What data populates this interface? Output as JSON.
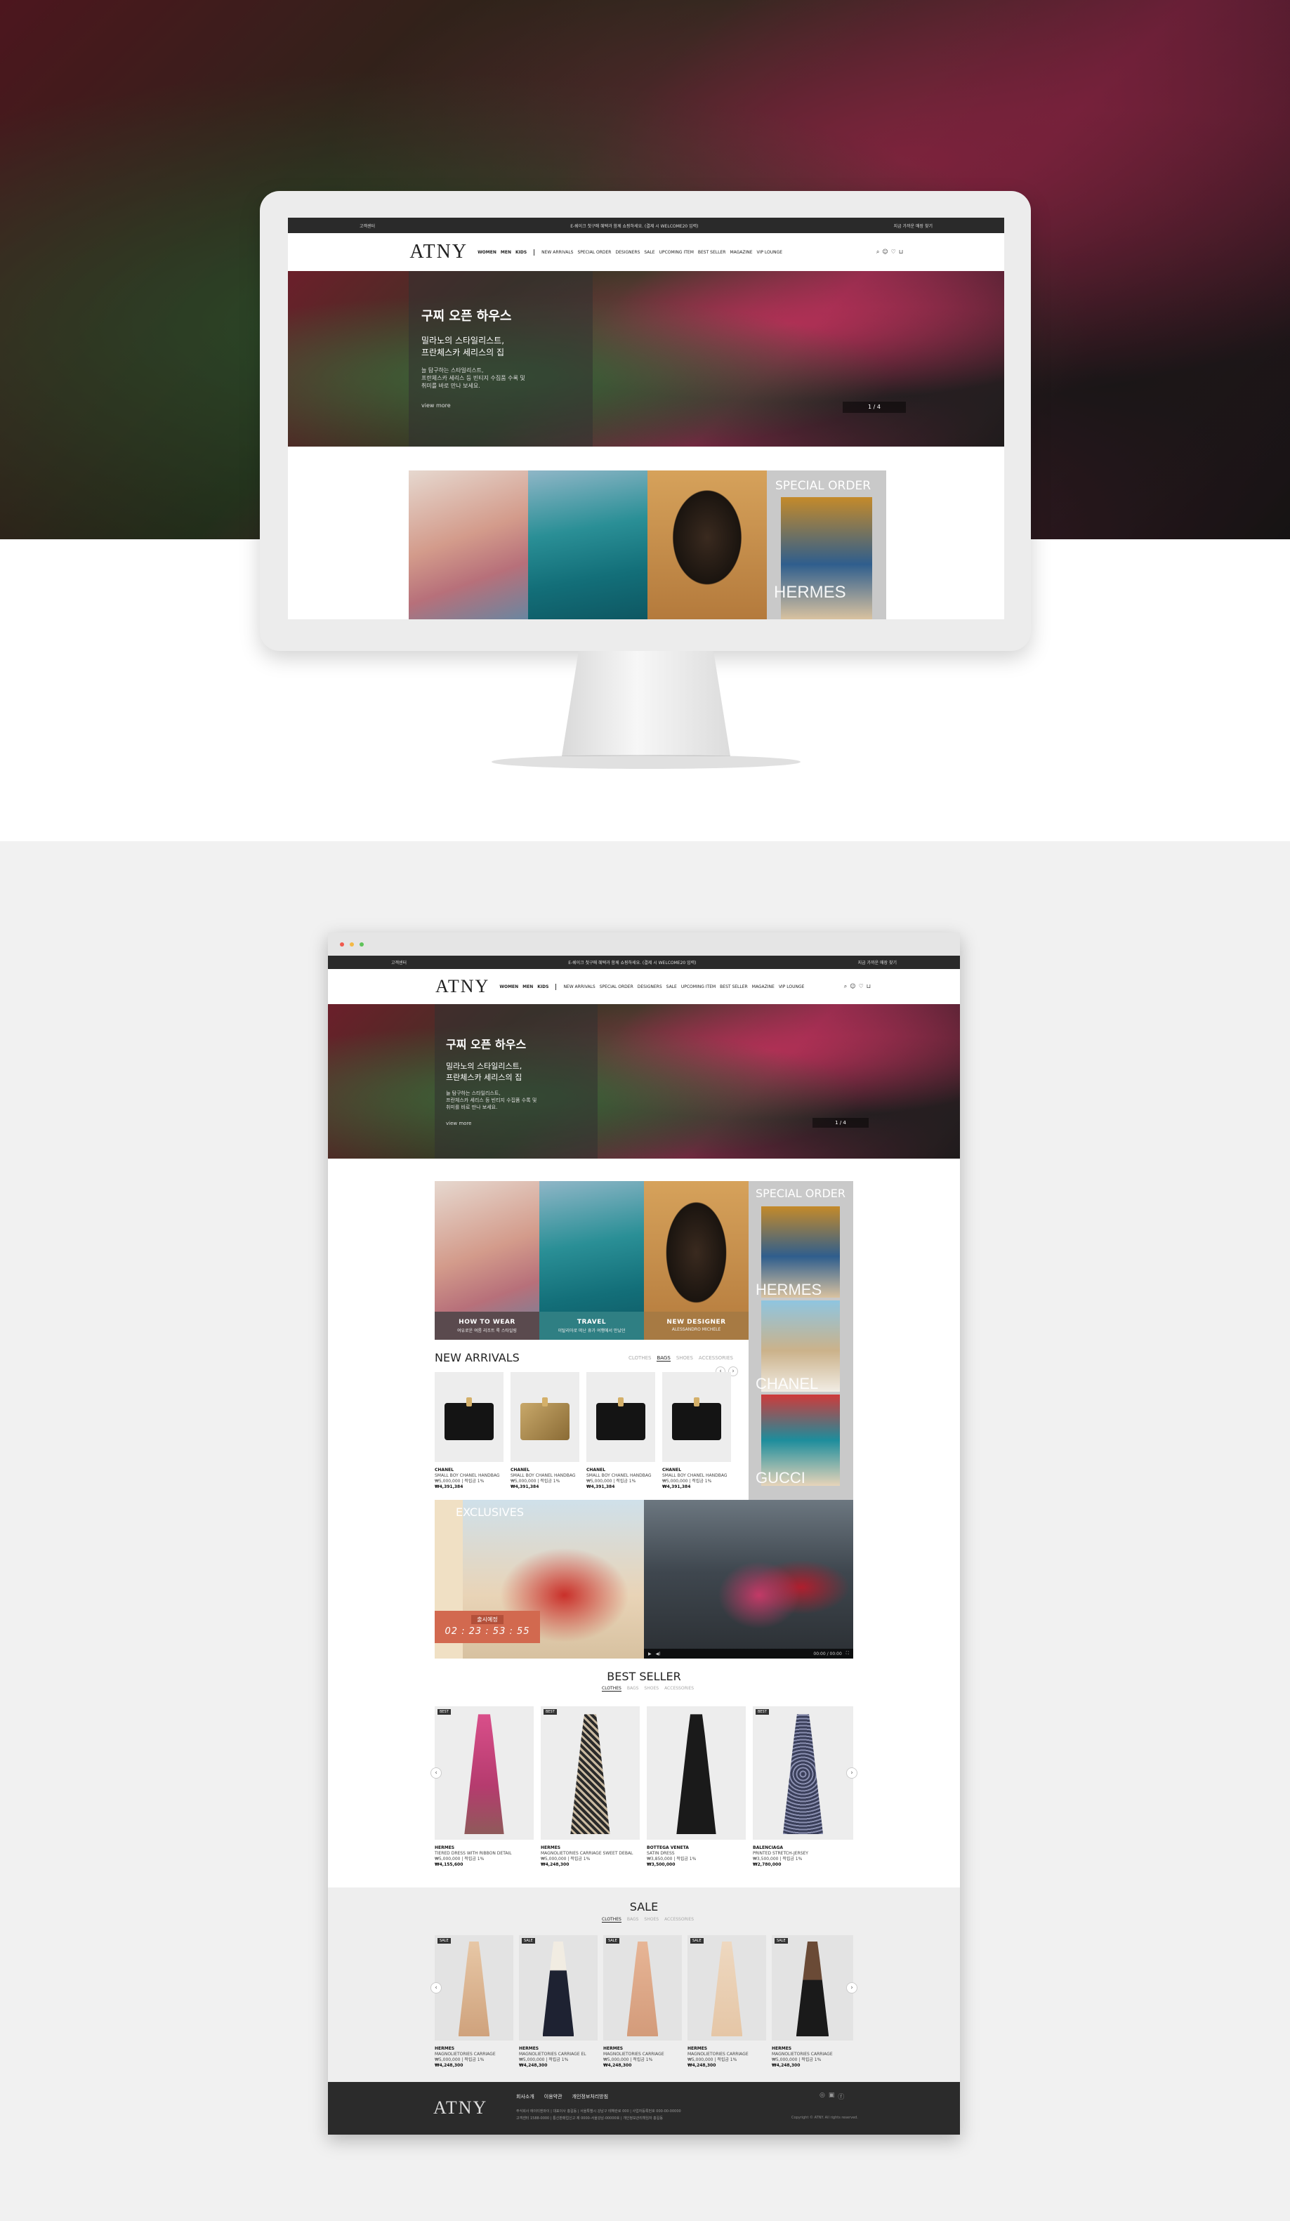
{
  "site": {
    "logo": "ATNY",
    "topbar": {
      "left": "고객센터",
      "center": "E-쉐이크 첫구매 혜택과 함께 쇼핑하세요. (결제 시 WELCOME20 입력)",
      "right": "지금 가까운 매장 찾기"
    },
    "menu": {
      "primary": [
        "WOMEN",
        "MEN",
        "KIDS"
      ],
      "secondary": [
        "NEW ARRIVALS",
        "SPECIAL ORDER",
        "DESIGNERS",
        "SALE",
        "UPCOMING ITEM",
        "BEST SELLER",
        "MAGAZINE",
        "VIP LOUNGE"
      ]
    },
    "tools": [
      "search-icon",
      "user-icon",
      "heart-icon",
      "bag-icon"
    ]
  },
  "hero": {
    "title": "구찌 오픈 하우스",
    "subtitle_line1": "밀라노의 스타일리스트,",
    "subtitle_line2": "프란체스카 세리스의 집",
    "body_line1": "늘 탐구하는 스타일리스트,",
    "body_line2": "프란체스카 세리스 등 빈티지 수집품 수록 및",
    "body_line3": "취미를 바로 만나 보세요.",
    "more": "view more",
    "pager": "1 / 4"
  },
  "tiles": [
    {
      "title": "HOW TO WEAR",
      "sub": "여유로운 여름 리조트 룩 스타일링"
    },
    {
      "title": "TRAVEL",
      "sub": "이탈리아로 떠난 휴가 여행에서 만났던"
    },
    {
      "title": "NEW DESIGNER",
      "sub": "ALESSANDRO MICHELE"
    }
  ],
  "special_order": {
    "title": "SPECIAL ORDER",
    "brands": [
      "HERMES",
      "CHANEL",
      "GUCCI"
    ]
  },
  "new_arrivals": {
    "title": "NEW ARRIVALS",
    "tabs": [
      "CLOTHES",
      "BAGS",
      "SHOES",
      "ACCESSORIES"
    ],
    "active_tab": "BAGS",
    "items": [
      {
        "brand": "CHANEL",
        "name": "SMALL BOY CHANEL HANDBAG",
        "sub": "₩5,000,000 | 적립금 1%",
        "price": "₩4,391,384"
      },
      {
        "brand": "CHANEL",
        "name": "SMALL BOY CHANEL HANDBAG",
        "sub": "₩5,000,000 | 적립금 1%",
        "price": "₩4,391,384"
      },
      {
        "brand": "CHANEL",
        "name": "SMALL BOY CHANEL HANDBAG",
        "sub": "₩5,000,000 | 적립금 1%",
        "price": "₩4,391,384"
      },
      {
        "brand": "CHANEL",
        "name": "SMALL BOY CHANEL HANDBAG",
        "sub": "₩5,000,000 | 적립금 1%",
        "price": "₩4,391,384"
      }
    ]
  },
  "exclusives": {
    "title": "EXCLUSIVES",
    "label": "출시예정",
    "countdown": "02 : 23 : 53 : 55",
    "video_time": "00:00 / 00:00"
  },
  "best_seller": {
    "title": "BEST SELLER",
    "tabs": [
      "CLOTHES",
      "BAGS",
      "SHOES",
      "ACCESSORIES"
    ],
    "active_tab": "CLOTHES",
    "badge": "BEST",
    "items": [
      {
        "brand": "HERMES",
        "name": "TIERED DRESS WITH RIBBON DETAIL",
        "sub": "₩5,000,000 | 적립금 1%",
        "price": "₩4,155,600"
      },
      {
        "brand": "HERMES",
        "name": "MAGNOLIETORIES CARRIAGE SWEET DEBAL",
        "sub": "₩5,000,000 | 적립금 1%",
        "price": "₩4,248,300"
      },
      {
        "brand": "BOTTEGA VENETA",
        "name": "SATIN DRESS",
        "sub": "₩3,850,000 | 적립금 1%",
        "price": "₩3,500,000"
      },
      {
        "brand": "BALENCIAGA",
        "name": "PRINTED STRETCH-JERSEY",
        "sub": "₩3,500,000 | 적립금 1%",
        "price": "₩2,780,000"
      }
    ]
  },
  "sale": {
    "title": "SALE",
    "tabs": [
      "CLOTHES",
      "BAGS",
      "SHOES",
      "ACCESSORIES"
    ],
    "active_tab": "CLOTHES",
    "badge": "SALE",
    "items": [
      {
        "brand": "HERMES",
        "name": "MAGNOLIETORIES CARRIAGE",
        "sub": "₩5,000,000 | 적립금 1%",
        "price": "₩4,248,300"
      },
      {
        "brand": "HERMES",
        "name": "MAGNOLIETORIES CARRIAGE EL",
        "sub": "₩5,000,000 | 적립금 1%",
        "price": "₩4,248,300"
      },
      {
        "brand": "HERMES",
        "name": "MAGNOLIETORIES CARRIAGE",
        "sub": "₩5,000,000 | 적립금 1%",
        "price": "₩4,248,300"
      },
      {
        "brand": "HERMES",
        "name": "MAGNOLIETORIES CARRIAGE",
        "sub": "₩5,000,000 | 적립금 1%",
        "price": "₩4,248,300"
      },
      {
        "brand": "HERMES",
        "name": "MAGNOLIETORIES CARRIAGE",
        "sub": "₩5,000,000 | 적립금 1%",
        "price": "₩4,248,300"
      }
    ]
  },
  "footer": {
    "links": [
      "회사소개",
      "이용약관",
      "개인정보처리방침"
    ],
    "line1": "주식회사 에이티엔와이 | 대표이사 홍길동 | 서울특별시 강남구 테헤란로 000 | 사업자등록번호 000-00-00000",
    "line2": "고객센터 1588-0000 | 통신판매업신고 제 0000-서울강남-00000호 | 개인정보관리책임자 홍길동",
    "copyright": "Copyright © ATNY. All rights reserved."
  },
  "colors": {
    "accent_countdown": "#d2694f",
    "dark": "#2b2b2b",
    "special_order_bg": "#c9c9c9"
  }
}
